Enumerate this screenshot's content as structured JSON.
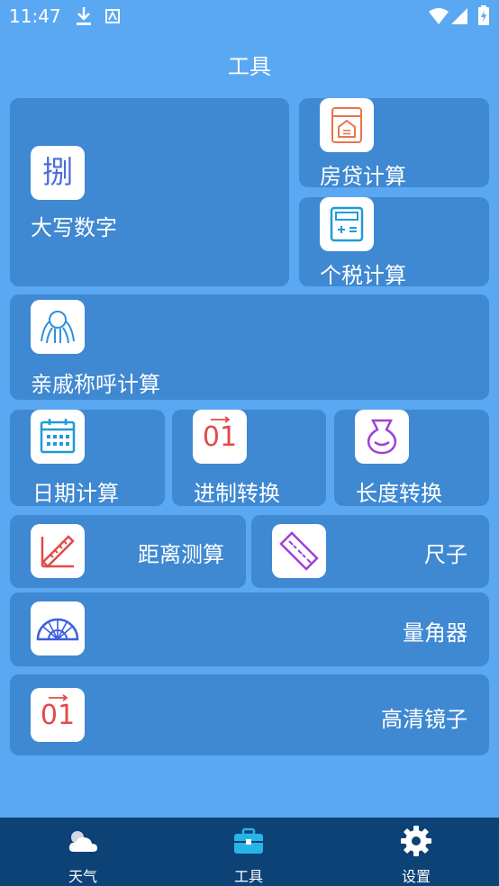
{
  "status": {
    "time": "11:47"
  },
  "header": {
    "title": "工具"
  },
  "tools": {
    "daxie": {
      "label": "大写数字",
      "glyph": "捌"
    },
    "fangdai": {
      "label": "房贷计算"
    },
    "geshui": {
      "label": "个税计算"
    },
    "qinqi": {
      "label": "亲戚称呼计算"
    },
    "riqi": {
      "label": "日期计算"
    },
    "jinzhi": {
      "label": "进制转换",
      "glyph": "01"
    },
    "changdu": {
      "label": "长度转换"
    },
    "juli": {
      "label": "距离测算"
    },
    "chizi": {
      "label": "尺子"
    },
    "liangjiao": {
      "label": "量角器"
    },
    "jingzi": {
      "label": "高清镜子",
      "glyph": "01"
    }
  },
  "bottom_nav": [
    {
      "label": "天气",
      "icon": "cloud-icon"
    },
    {
      "label": "工具",
      "icon": "toolbox-icon"
    },
    {
      "label": "设置",
      "icon": "gear-icon"
    }
  ],
  "colors": {
    "background": "#5aa8f2",
    "card": "#3f88d2",
    "nav": "#0d4276",
    "active_tab": "#28b4e8",
    "red_accent": "#e24a4a",
    "orange_accent": "#e8754a"
  }
}
